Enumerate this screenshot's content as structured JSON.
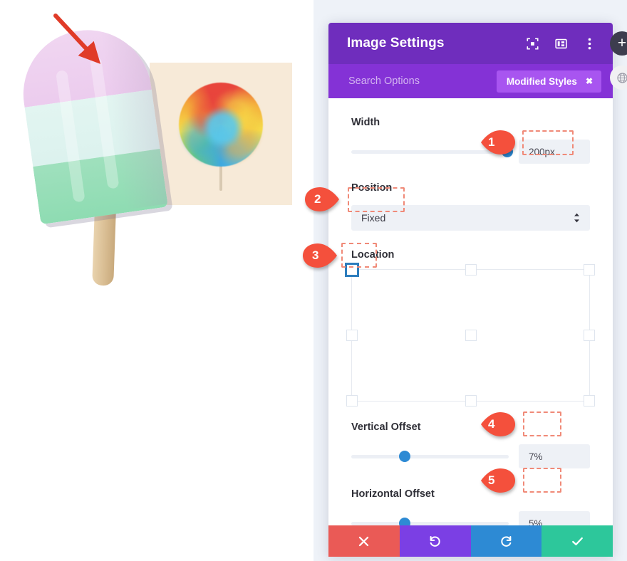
{
  "panel": {
    "title": "Image Settings",
    "header_icons": [
      {
        "name": "fullscreen-icon",
        "label": "Fullscreen"
      },
      {
        "name": "layout-columns-icon",
        "label": "Layout"
      },
      {
        "name": "more-vertical-icon",
        "label": "More"
      }
    ],
    "search": {
      "placeholder": "Search Options",
      "value": ""
    },
    "badge": {
      "label": "Modified Styles",
      "close": "✖",
      "color": "#a855f0"
    },
    "fields": [
      {
        "label": "Width",
        "type": "slider",
        "value": "200px",
        "knob_percent": 99
      },
      {
        "label": "Position",
        "type": "select",
        "value": "Fixed"
      },
      {
        "label": "Location",
        "type": "grid",
        "selected": "top-left"
      },
      {
        "label": "Vertical Offset",
        "type": "slider",
        "value": "7%",
        "knob_percent": 34
      },
      {
        "label": "Horizontal Offset",
        "type": "slider",
        "value": "5%",
        "knob_percent": 34
      }
    ],
    "actions": [
      {
        "name": "cancel-button",
        "glyph": "✖",
        "color": "#ea5a56"
      },
      {
        "name": "undo-button",
        "glyph": "↺",
        "color": "#7b3fe4"
      },
      {
        "name": "redo-button",
        "glyph": "↻",
        "color": "#2d8ad4"
      },
      {
        "name": "save-button",
        "glyph": "✔",
        "color": "#2dc79b"
      }
    ],
    "theme": {
      "header_purple": "#6f2dbd",
      "search_purple": "#8432d6",
      "accent_blue": "#2d8ad4",
      "annotation_red": "#f4503c",
      "dash_outline": "#f08a78"
    }
  },
  "rail": {
    "add_label": "+",
    "add_icon": "plus-icon",
    "globe_icon": "globe-icon"
  },
  "callouts": [
    {
      "number": "1",
      "target": "width-value-field"
    },
    {
      "number": "2",
      "target": "position-select"
    },
    {
      "number": "3",
      "target": "location-top-left-handle"
    },
    {
      "number": "4",
      "target": "vertical-offset-value-field"
    },
    {
      "number": "5",
      "target": "horizontal-offset-value-field"
    }
  ],
  "canvas": {
    "popsicle_alt": "tri-color popsicle illustration",
    "lollipop_alt": "rainbow swirl lollipop illustration",
    "arrow_alt": "red pointer arrow"
  }
}
